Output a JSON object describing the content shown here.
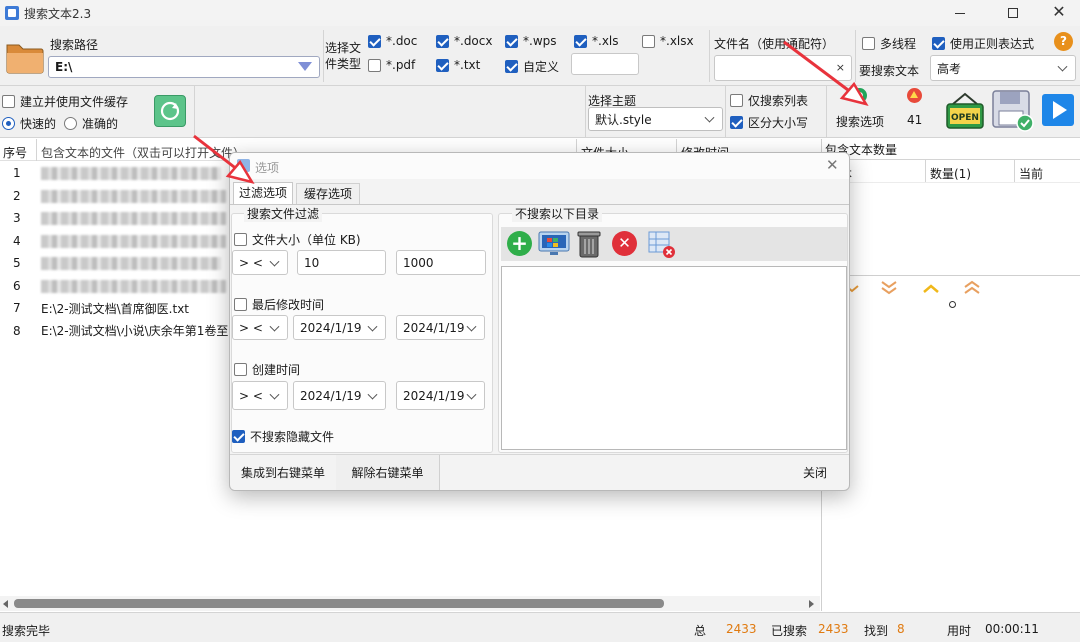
{
  "window": {
    "title": "搜索文本2.3"
  },
  "toolbar": {
    "search_path_label": "搜索路径",
    "search_path_value": "E:\\",
    "file_type_label": "选择文件类型",
    "file_types": [
      {
        "label": "*.doc",
        "checked": true
      },
      {
        "label": "*.docx",
        "checked": true
      },
      {
        "label": "*.wps",
        "checked": true
      },
      {
        "label": "*.xls",
        "checked": true
      },
      {
        "label": "*.xlsx",
        "checked": false
      },
      {
        "label": "*.pdf",
        "checked": false
      },
      {
        "label": "*.txt",
        "checked": true
      },
      {
        "label": "自定义",
        "checked": true
      }
    ],
    "custom_type_value": "",
    "filename_label": "文件名（使用通配符）",
    "filename_value": "",
    "multithread_label": "多线程",
    "regex_label": "使用正则表达式",
    "search_text_label": "要搜索文本",
    "search_text_value": "高考",
    "build_cache_label": "建立并使用文件缓存",
    "fast_label": "快速的",
    "accurate_label": "准确的",
    "theme_label": "选择主题",
    "theme_value": "默认.style",
    "only_list_label": "仅搜索列表",
    "case_label": "区分大小写",
    "search_options_label": "搜索选项",
    "count_value": "41"
  },
  "table": {
    "headers": [
      "序号",
      "包含文本的文件（双击可以打开文件）",
      "文件大小",
      "修改时间"
    ],
    "rows": [
      {
        "num": "1",
        "path": ""
      },
      {
        "num": "2",
        "path": ""
      },
      {
        "num": "3",
        "path": ""
      },
      {
        "num": "4",
        "path": ""
      },
      {
        "num": "5",
        "path": ""
      },
      {
        "num": "6",
        "path": ""
      },
      {
        "num": "7",
        "path": "E:\\2-测试文档\\首席御医.txt"
      },
      {
        "num": "8",
        "path": "E:\\2-测试文档\\小说\\庆余年第1卷至第"
      }
    ]
  },
  "right_panel": {
    "title": "包含文本数量",
    "headers": [
      "文本",
      "数量(1)",
      "当前"
    ]
  },
  "dialog": {
    "title": "选项",
    "tabs": [
      "过滤选项",
      "缓存选项"
    ],
    "filter_group": "搜索文件过滤",
    "size_label": "文件大小（单位 KB)",
    "size_op": "> <",
    "size_min": "10",
    "size_max": "1000",
    "modified_label": "最后修改时间",
    "modified_op": "> <",
    "modified_from": "2024/1/19",
    "modified_to": "2024/1/19",
    "created_label": "创建时间",
    "created_op": "> <",
    "created_from": "2024/1/19",
    "created_to": "2024/1/19",
    "hidden_label": "不搜索隐藏文件",
    "exclude_group": "不搜索以下目录",
    "integrate_label": "集成到右键菜单",
    "remove_label": "解除右键菜单",
    "close_label": "关闭"
  },
  "status": {
    "text": "搜索完毕",
    "total_label": "总",
    "total_value": "2433",
    "searched_label": "已搜索",
    "searched_value": "2433",
    "found_label": "找到",
    "found_value": "8",
    "time_label": "用时",
    "time_value": "00:00:11"
  },
  "colors": {
    "accent": "#1f5fbf",
    "orange": "#e07a10",
    "red_arrow": "#e8333c"
  }
}
